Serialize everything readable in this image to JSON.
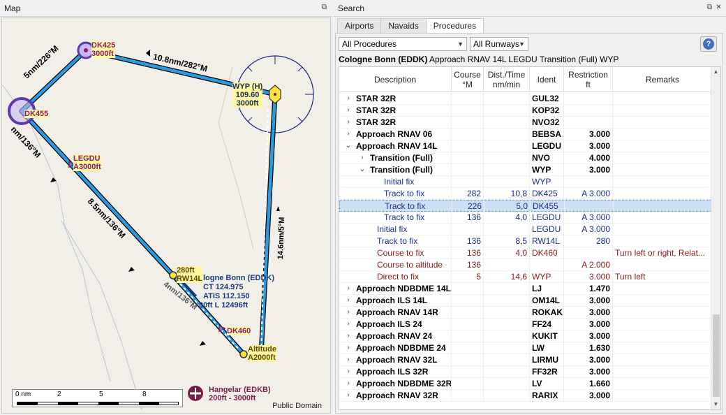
{
  "map_dock": {
    "title": "Map",
    "attribution": "Public Domain"
  },
  "map": {
    "scale": {
      "labels": [
        "0 nm",
        "2",
        "5",
        "8"
      ]
    },
    "legs": [
      {
        "label": "5nm/226°M"
      },
      {
        "label": "10.8nm/282°M"
      },
      {
        "label": "8.5nm/136°M"
      },
      {
        "label": "14.6nm/5°M"
      },
      {
        "label": "4nm/136°M"
      },
      {
        "label": "nm/136°M"
      }
    ],
    "fixes": {
      "dk425": {
        "name": "DK425",
        "alt": "3000ft"
      },
      "dk455": {
        "name": "DK455"
      },
      "legdu": {
        "name": "LEGDU",
        "alt": "A3000ft"
      },
      "wyp": {
        "name": "WYP (H)",
        "freq": "109.60",
        "alt": "3000ft"
      },
      "rw14l": {
        "alt": "280ft",
        "name": "RW14L"
      },
      "dk460": {
        "name": "DK460"
      },
      "altitude": {
        "name": "Altitude",
        "alt": "A2000ft"
      }
    },
    "airport": {
      "name": "logne Bonn (EDDK)",
      "ct": "CT 124.975",
      "atis": "ATIS 112.150",
      "rwy": "00ft L 12496ft"
    },
    "hangelar": {
      "name": "Hangelar (EDKB)",
      "alt": "200ft - 3000ft"
    }
  },
  "search_dock": {
    "title": "Search",
    "tabs": [
      "Airports",
      "Navaids",
      "Procedures"
    ],
    "active_tab": "Procedures",
    "filter_procedures": "All Procedures",
    "filter_runways": "All Runways",
    "help_label": "?",
    "airport_label": "Cologne Bonn (EDDK)",
    "procedure_label": "Approach RNAV 14L LEGDU Transition (Full) WYP",
    "columns": [
      "Description",
      "Course\n°M",
      "Dist./Time\nnm/min",
      "Ident",
      "Restriction\nft",
      "Remarks"
    ],
    "rows": [
      {
        "indent": 0,
        "exp": "›",
        "desc": "STAR 32R",
        "course": "",
        "dist": "",
        "ident": "GUL32",
        "restr": "",
        "remarks": "",
        "style": "b"
      },
      {
        "indent": 0,
        "exp": "›",
        "desc": "STAR 32R",
        "course": "",
        "dist": "",
        "ident": "KOP32",
        "restr": "",
        "remarks": "",
        "style": "b"
      },
      {
        "indent": 0,
        "exp": "›",
        "desc": "STAR 32R",
        "course": "",
        "dist": "",
        "ident": "NVO32",
        "restr": "",
        "remarks": "",
        "style": "b"
      },
      {
        "indent": 0,
        "exp": "›",
        "desc": "Approach RNAV 06",
        "course": "",
        "dist": "",
        "ident": "BEBSA",
        "restr": "3.000",
        "remarks": "",
        "style": "b"
      },
      {
        "indent": 0,
        "exp": "⌄",
        "desc": "Approach RNAV 14L",
        "course": "",
        "dist": "",
        "ident": "LEGDU",
        "restr": "3.000",
        "remarks": "",
        "style": "b"
      },
      {
        "indent": 1,
        "exp": "›",
        "desc": "Transition (Full)",
        "course": "",
        "dist": "",
        "ident": "NVO",
        "restr": "4.000",
        "remarks": "",
        "style": "b"
      },
      {
        "indent": 1,
        "exp": "⌄",
        "desc": "Transition (Full)",
        "course": "",
        "dist": "",
        "ident": "WYP",
        "restr": "3.000",
        "remarks": "",
        "style": "b"
      },
      {
        "indent": 2,
        "exp": "",
        "desc": "Initial fix",
        "course": "",
        "dist": "",
        "ident": "WYP",
        "restr": "",
        "remarks": "",
        "style": "c-blue"
      },
      {
        "indent": 2,
        "exp": "",
        "desc": "Track to fix",
        "course": "282",
        "dist": "10,8",
        "ident": "DK425",
        "restr": "A 3.000",
        "remarks": "",
        "style": "c-blue"
      },
      {
        "indent": 2,
        "exp": "",
        "desc": "Track to fix",
        "course": "226",
        "dist": "5,0",
        "ident": "DK455",
        "restr": "",
        "remarks": "",
        "style": "c-blue",
        "selected": true
      },
      {
        "indent": 2,
        "exp": "",
        "desc": "Track to fix",
        "course": "136",
        "dist": "4,0",
        "ident": "LEGDU",
        "restr": "A 3.000",
        "remarks": "",
        "style": "c-blue"
      },
      {
        "indent": 1.5,
        "exp": "",
        "desc": "Initial fix",
        "course": "",
        "dist": "",
        "ident": "LEGDU",
        "restr": "A 3.000",
        "remarks": "",
        "style": "c-blue"
      },
      {
        "indent": 1.5,
        "exp": "",
        "desc": "Track to fix",
        "course": "136",
        "dist": "8,5",
        "ident": "RW14L",
        "restr": "280",
        "remarks": "",
        "style": "c-blue"
      },
      {
        "indent": 1.5,
        "exp": "",
        "desc": "Course to fix",
        "course": "136",
        "dist": "4,0",
        "ident": "DK460",
        "restr": "",
        "remarks": "Turn left or right, Relat...",
        "style": "c-red"
      },
      {
        "indent": 1.5,
        "exp": "",
        "desc": "Course to altitude",
        "course": "136",
        "dist": "",
        "ident": "",
        "restr": "A 2.000",
        "remarks": "",
        "style": "c-red"
      },
      {
        "indent": 1.5,
        "exp": "",
        "desc": "Direct to fix",
        "course": "5",
        "dist": "14,6",
        "ident": "WYP",
        "restr": "3.000",
        "remarks": "Turn left",
        "style": "c-red"
      },
      {
        "indent": 0,
        "exp": "›",
        "desc": "Approach NDBDME 14L",
        "course": "",
        "dist": "",
        "ident": "LJ",
        "restr": "1.470",
        "remarks": "",
        "style": "b"
      },
      {
        "indent": 0,
        "exp": "›",
        "desc": "Approach ILS 14L",
        "course": "",
        "dist": "",
        "ident": "OM14L",
        "restr": "3.000",
        "remarks": "",
        "style": "b"
      },
      {
        "indent": 0,
        "exp": "›",
        "desc": "Approach RNAV 14R",
        "course": "",
        "dist": "",
        "ident": "ROKAK",
        "restr": "3.000",
        "remarks": "",
        "style": "b"
      },
      {
        "indent": 0,
        "exp": "›",
        "desc": "Approach ILS 24",
        "course": "",
        "dist": "",
        "ident": "FF24",
        "restr": "3.000",
        "remarks": "",
        "style": "b"
      },
      {
        "indent": 0,
        "exp": "›",
        "desc": "Approach RNAV 24",
        "course": "",
        "dist": "",
        "ident": "KUKIT",
        "restr": "3.000",
        "remarks": "",
        "style": "b"
      },
      {
        "indent": 0,
        "exp": "›",
        "desc": "Approach NDBDME 24",
        "course": "",
        "dist": "",
        "ident": "LW",
        "restr": "1.630",
        "remarks": "",
        "style": "b"
      },
      {
        "indent": 0,
        "exp": "›",
        "desc": "Approach RNAV 32L",
        "course": "",
        "dist": "",
        "ident": "LIRMU",
        "restr": "3.000",
        "remarks": "",
        "style": "b"
      },
      {
        "indent": 0,
        "exp": "›",
        "desc": "Approach ILS 32R",
        "course": "",
        "dist": "",
        "ident": "FF32R",
        "restr": "3.000",
        "remarks": "",
        "style": "b"
      },
      {
        "indent": 0,
        "exp": "›",
        "desc": "Approach NDBDME 32R",
        "course": "",
        "dist": "",
        "ident": "LV",
        "restr": "1.660",
        "remarks": "",
        "style": "b"
      },
      {
        "indent": 0,
        "exp": "›",
        "desc": "Approach RNAV 32R",
        "course": "",
        "dist": "",
        "ident": "RARIX",
        "restr": "3.000",
        "remarks": "",
        "style": "b"
      }
    ]
  },
  "colors": {
    "route_blue": "#2a9be0",
    "fix_magenta": "#8b1a6b",
    "label_bg": "#fff8a0",
    "hangelar": "#7a1f4a"
  }
}
